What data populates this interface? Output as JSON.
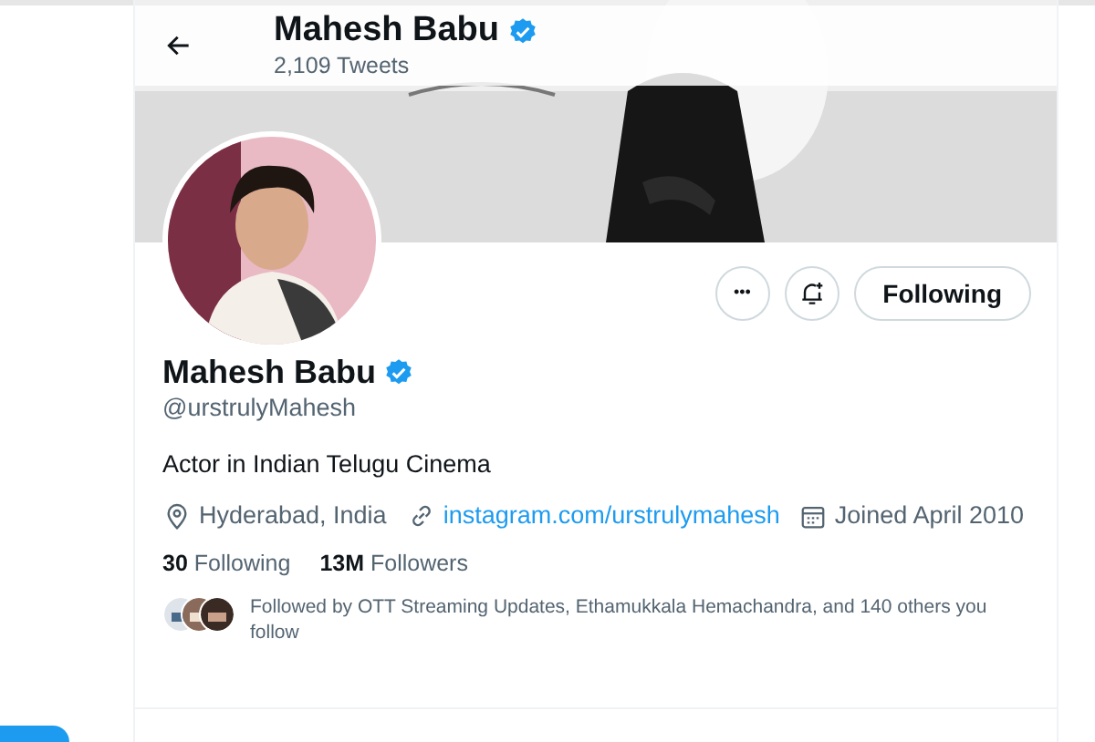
{
  "header": {
    "name": "Mahesh Babu",
    "verified": true,
    "tweet_count": "2,109 Tweets"
  },
  "actions": {
    "more": "•••",
    "follow_button": "Following"
  },
  "profile": {
    "name": "Mahesh Babu",
    "verified": true,
    "handle": "@urstrulyMahesh",
    "bio": "Actor in Indian Telugu Cinema"
  },
  "meta": [
    {
      "kind": "location",
      "text": "Hyderabad, India"
    },
    {
      "kind": "link",
      "text": "instagram.com/urstrulymahesh"
    },
    {
      "kind": "joined",
      "text": "Joined April 2010"
    }
  ],
  "stats": [
    {
      "count": "30",
      "label": "Following"
    },
    {
      "count": "13M",
      "label": "Followers"
    }
  ],
  "followed_by": "Followed by OTT Streaming Updates, Ethamukkala Hemachandra, and 140 others you follow"
}
